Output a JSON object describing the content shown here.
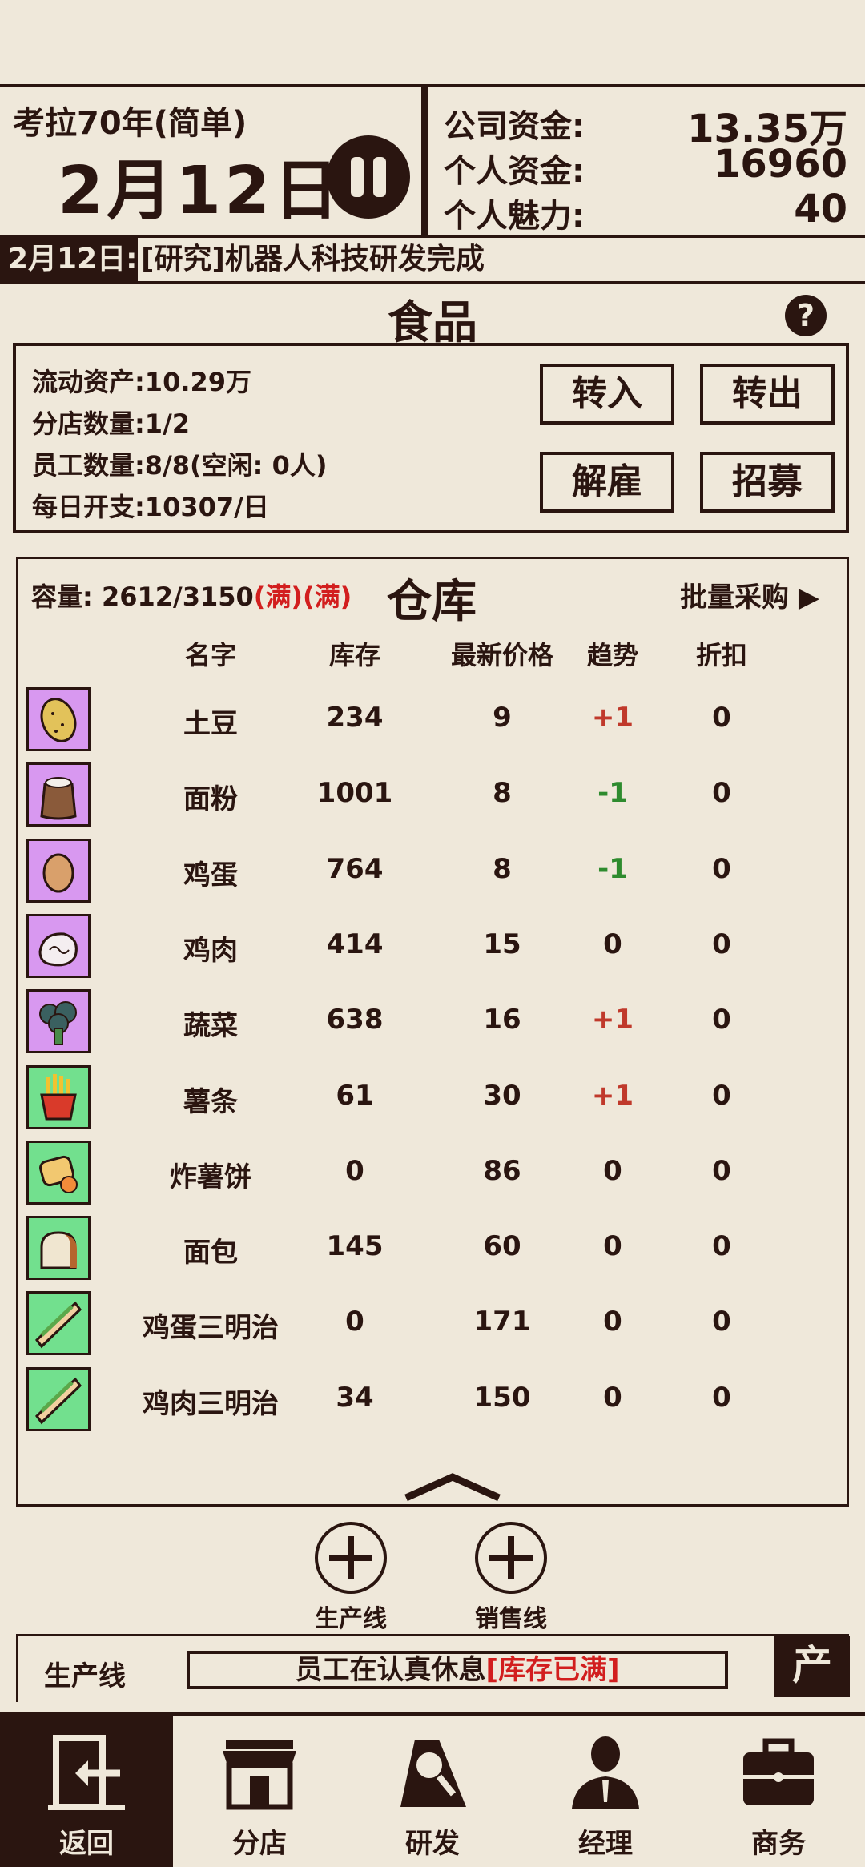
{
  "header": {
    "scenario": "考拉70年(简单)",
    "date": "2月12日",
    "company_funds_label": "公司资金:",
    "company_funds": "13.35万",
    "personal_funds_label": "个人资金:",
    "personal_funds": "16960",
    "charm_label": "个人魅力:",
    "charm": "40"
  },
  "news": {
    "date": "2月12日:",
    "text": "[研究]机器人科技研发完成"
  },
  "category": {
    "title": "食品",
    "help_icon": "?"
  },
  "info": {
    "current_assets": "流动资产:10.29万",
    "branches": "分店数量:1/2",
    "employees": "员工数量:8/8(空闲: 0人)",
    "daily_cost": "每日开支:10307/日",
    "buttons": {
      "transfer_in": "转入",
      "transfer_out": "转出",
      "fire": "解雇",
      "hire": "招募"
    }
  },
  "warehouse": {
    "capacity": "容量:  2612/3150",
    "capacity_flags": "(满)(满)",
    "title": "仓库",
    "bulk_purchase": "批量采购 ▶",
    "columns": [
      "名字",
      "库存",
      "最新价格",
      "趋势",
      "折扣"
    ],
    "items": [
      {
        "name": "土豆",
        "stock": "234",
        "price": "9",
        "trend": "+1",
        "discount": "0",
        "icon": "potato-icon",
        "bg": "#d898f0"
      },
      {
        "name": "面粉",
        "stock": "1001",
        "price": "8",
        "trend": "-1",
        "discount": "0",
        "icon": "flour-sack-icon",
        "bg": "#d898f0"
      },
      {
        "name": "鸡蛋",
        "stock": "764",
        "price": "8",
        "trend": "-1",
        "discount": "0",
        "icon": "egg-icon",
        "bg": "#d898f0"
      },
      {
        "name": "鸡肉",
        "stock": "414",
        "price": "15",
        "trend": "0",
        "discount": "0",
        "icon": "chicken-meat-icon",
        "bg": "#d898f0"
      },
      {
        "name": "蔬菜",
        "stock": "638",
        "price": "16",
        "trend": "+1",
        "discount": "0",
        "icon": "broccoli-icon",
        "bg": "#d898f0"
      },
      {
        "name": "薯条",
        "stock": "61",
        "price": "30",
        "trend": "+1",
        "discount": "0",
        "icon": "fries-icon",
        "bg": "#72e08e"
      },
      {
        "name": "炸薯饼",
        "stock": "0",
        "price": "86",
        "trend": "0",
        "discount": "0",
        "icon": "hash-brown-icon",
        "bg": "#72e08e"
      },
      {
        "name": "面包",
        "stock": "145",
        "price": "60",
        "trend": "0",
        "discount": "0",
        "icon": "bread-icon",
        "bg": "#72e08e"
      },
      {
        "name": "鸡蛋三明治",
        "stock": "0",
        "price": "171",
        "trend": "0",
        "discount": "0",
        "icon": "sandwich-icon",
        "bg": "#72e08e"
      },
      {
        "name": "鸡肉三明治",
        "stock": "34",
        "price": "150",
        "trend": "0",
        "discount": "0",
        "icon": "sandwich-icon",
        "bg": "#72e08e"
      }
    ]
  },
  "add_lines": {
    "production": "生产线",
    "sales": "销售线"
  },
  "production_bar": {
    "label": "生产线",
    "status": "员工在认真休息",
    "status_flag": "[库存已满]",
    "tab": "产"
  },
  "nav": {
    "back": "返回",
    "branch": "分店",
    "research": "研发",
    "manager": "经理",
    "business": "商务"
  }
}
